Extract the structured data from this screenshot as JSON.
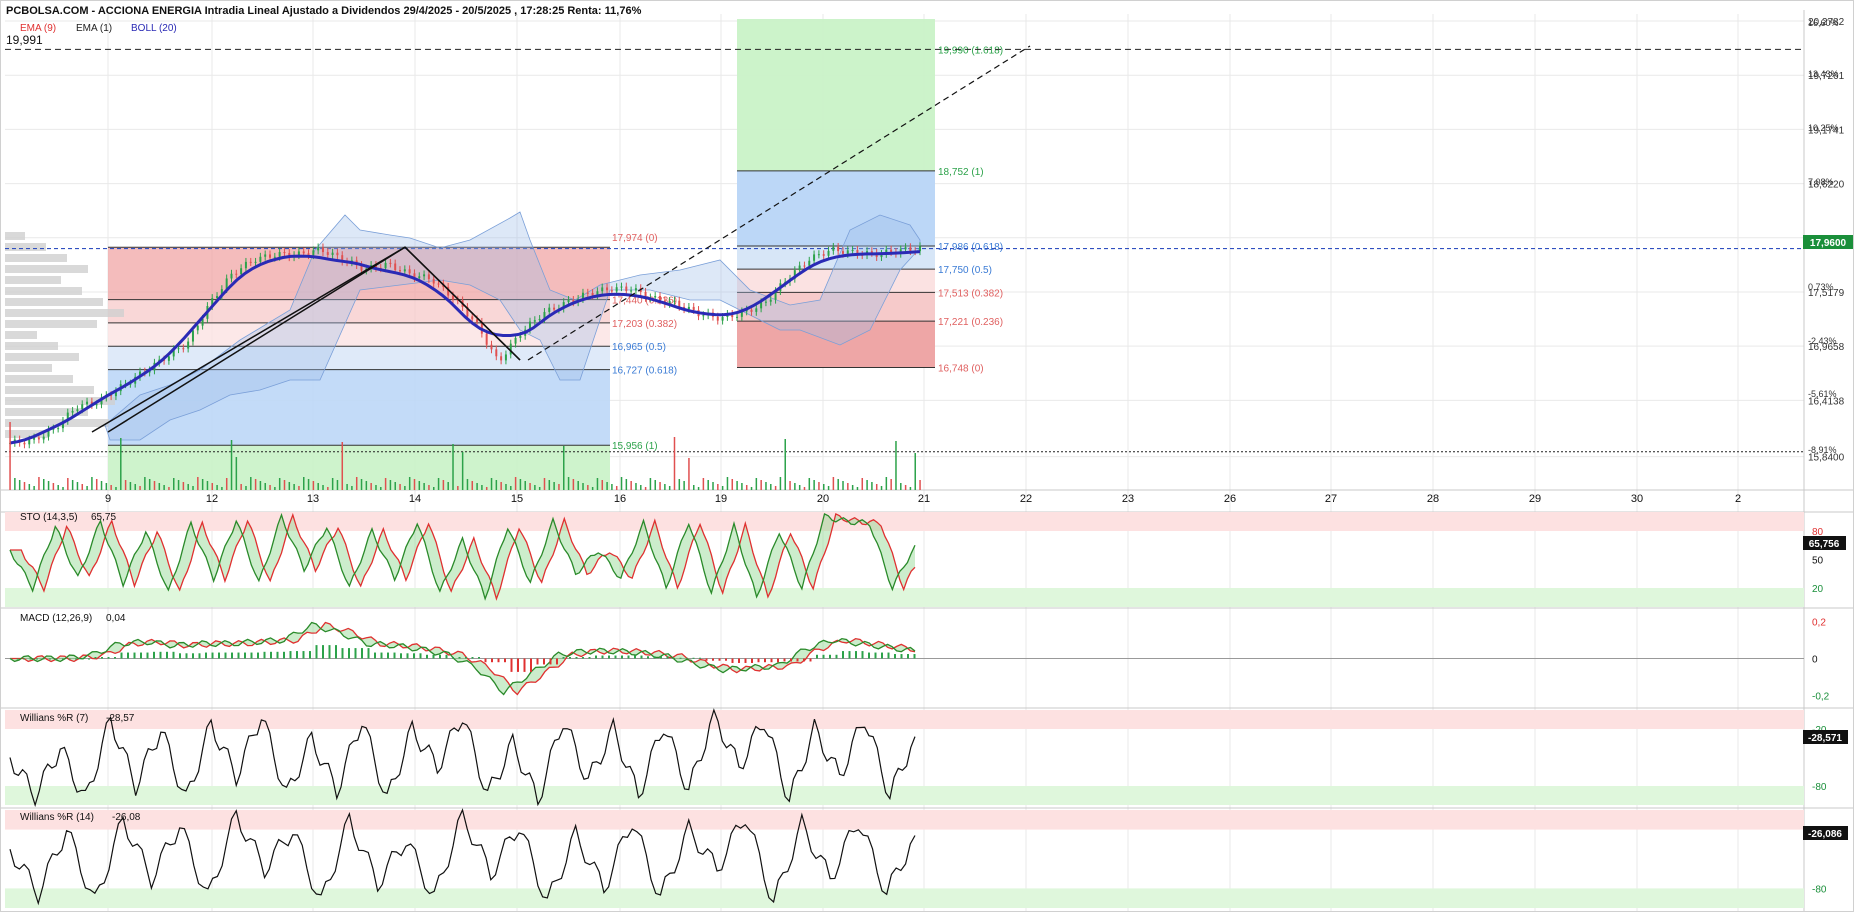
{
  "header": {
    "title": "PCBOLSA.COM - ACCIONA ENERGIA Intradia Lineal Ajustado a Dividendos 29/4/2025 - 20/5/2025 , 17:28:25 Renta: 11,76%",
    "legend": [
      {
        "label": "EMA (9)",
        "color": "#e03030"
      },
      {
        "label": "EMA (1)",
        "color": "#222222"
      },
      {
        "label": "BOLL (20)",
        "color": "#2a2ab5"
      }
    ],
    "last_label": "19,991"
  },
  "colors": {
    "ema9": "#e03030",
    "boll": "#2a2ab5",
    "up": "#2ca24a",
    "down": "#e05050",
    "fib_green": "#c9f2c7",
    "fib_blue": "#bcd7f7",
    "fib_red": "#f0b9b9",
    "price_tag": "#1a8f3a"
  },
  "chart_data": [
    {
      "type": "line",
      "name": "price",
      "x_tick_labels": [
        "9",
        "12",
        "13",
        "14",
        "15",
        "16",
        "19",
        "20",
        "21",
        "22",
        "23",
        "26",
        "27",
        "28",
        "29",
        "30",
        "2"
      ],
      "y_axis_labels": [
        "20,2782",
        "19,7261",
        "19,1741",
        "18,6220",
        "18,0700",
        "17,5179",
        "16,9658",
        "16,4138",
        "15,8400"
      ],
      "y_axis_percent": [
        "16,60%",
        "13,43%",
        "10,25%",
        "7,08%",
        "0,73%",
        "-2,43%",
        "-5,61%",
        "-8,91%"
      ],
      "last_price": "17,9600",
      "reference_line": "19,990",
      "fib_left": [
        {
          "label": "17,974 (0)",
          "value": 17.974
        },
        {
          "label": "17,440 (0.236)",
          "value": 17.44
        },
        {
          "label": "17,203 (0.382)",
          "value": 17.203
        },
        {
          "label": "16,965 (0.5)",
          "value": 16.965
        },
        {
          "label": "16,727 (0.618)",
          "value": 16.727
        },
        {
          "label": "15,956 (1)",
          "value": 15.956
        }
      ],
      "fib_right": [
        {
          "label": "19,990 (1.618)",
          "value": 19.99
        },
        {
          "label": "18,752 (1)",
          "value": 18.752
        },
        {
          "label": "17,986 (0.618)",
          "value": 17.986
        },
        {
          "label": "17,750 (0.5)",
          "value": 17.75
        },
        {
          "label": "17,513 (0.382)",
          "value": 17.513
        },
        {
          "label": "17,221 (0.236)",
          "value": 17.221
        },
        {
          "label": "16,748 (0)",
          "value": 16.748
        }
      ],
      "series": [
        {
          "values": [
            15.98,
            16.0,
            16.12,
            16.35,
            16.4,
            16.55,
            16.7,
            16.85,
            17.0,
            17.4,
            17.7,
            17.85,
            17.9,
            17.9,
            17.95,
            17.85,
            17.75,
            17.8,
            17.7,
            17.65,
            17.45,
            17.2,
            16.8,
            17.1,
            17.3,
            17.4,
            17.5,
            17.55,
            17.55,
            17.45,
            17.4,
            17.3,
            17.25,
            17.3,
            17.4,
            17.65,
            17.85,
            17.95,
            17.92,
            17.9,
            17.94,
            17.96
          ]
        }
      ]
    },
    {
      "type": "line",
      "name": "STO (14,3,5)",
      "label": "STO (14,3,5)",
      "value_label": "65,75",
      "current": "65,756",
      "levels": [
        "80",
        "50",
        "20"
      ],
      "ylim": [
        0,
        100
      ],
      "series": [
        {
          "values": [
            60,
            20,
            85,
            30,
            90,
            25,
            80,
            15,
            88,
            30,
            92,
            25,
            95,
            40,
            85,
            20,
            80,
            30,
            90,
            15,
            70,
            10,
            85,
            25,
            90,
            35,
            60,
            30,
            88,
            20,
            90,
            15,
            85,
            10,
            80,
            20,
            95,
            90,
            88,
            20,
            65
          ]
        }
      ]
    },
    {
      "type": "line",
      "name": "MACD (12,26,9)",
      "label": "MACD (12,26,9)",
      "value_label": "0,04",
      "levels": [
        "0,2",
        "0",
        "-0,2"
      ],
      "ylim": [
        -0.25,
        0.25
      ],
      "series": [
        {
          "values": [
            0.0,
            0.0,
            0.0,
            0.02,
            0.08,
            0.09,
            0.07,
            0.08,
            0.08,
            0.09,
            0.1,
            0.18,
            0.14,
            0.08,
            0.07,
            0.05,
            0.02,
            -0.05,
            -0.18,
            -0.08,
            0.02,
            0.04,
            0.04,
            0.03,
            0.01,
            -0.03,
            -0.06,
            -0.05,
            -0.04,
            0.05,
            0.1,
            0.08,
            0.06,
            0.04
          ]
        }
      ]
    },
    {
      "type": "line",
      "name": "Willians %R (7)",
      "label": "Willians %R (7)",
      "value_label": "-28,57",
      "current": "-28,571",
      "levels": [
        "-20",
        "-80"
      ],
      "ylim": [
        -100,
        0
      ],
      "series": [
        {
          "values": [
            -50,
            -90,
            -40,
            -95,
            -10,
            -80,
            -20,
            -95,
            -15,
            -70,
            -5,
            -90,
            -30,
            -85,
            -10,
            -95,
            -20,
            -60,
            -5,
            -90,
            -35,
            -95,
            -10,
            -75,
            -20,
            -90,
            -15,
            -85,
            -5,
            -60,
            -10,
            -95,
            -20,
            -70,
            -8,
            -90,
            -28
          ]
        }
      ]
    },
    {
      "type": "line",
      "name": "Willians %R (14)",
      "label": "Willians %R (14)",
      "value_label": "-26,08",
      "current": "-26,086",
      "levels": [
        "-20",
        "-80"
      ],
      "ylim": [
        -100,
        0
      ],
      "series": [
        {
          "values": [
            -40,
            -85,
            -20,
            -95,
            -10,
            -70,
            -15,
            -90,
            -5,
            -60,
            -20,
            -95,
            -10,
            -75,
            -30,
            -90,
            -5,
            -65,
            -15,
            -95,
            -25,
            -80,
            -10,
            -90,
            -20,
            -60,
            -5,
            -95,
            -15,
            -70,
            -10,
            -85,
            -26
          ]
        }
      ]
    }
  ]
}
